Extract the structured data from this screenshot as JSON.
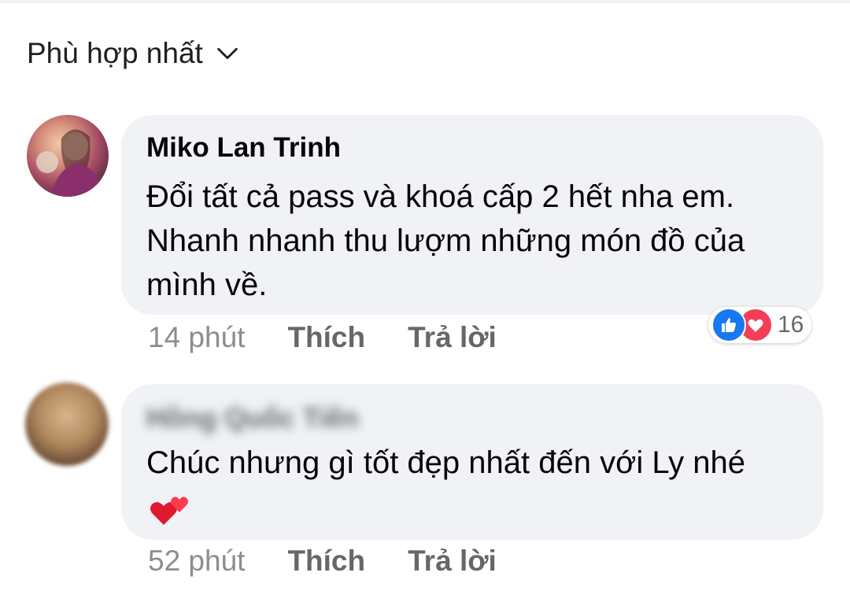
{
  "sort": {
    "label": "Phù hợp nhất",
    "icon": "chevron-down-icon"
  },
  "comments": [
    {
      "author": "Miko Lan Trinh",
      "text": "Đổi tất cả pass và khoá cấp 2 hết nha em. Nhanh nhanh thu lượm những món đồ của mình về.",
      "time": "14 phút",
      "like_label": "Thích",
      "reply_label": "Trả lời",
      "reactions": {
        "icons": [
          "like-icon",
          "love-icon"
        ],
        "count": "16"
      }
    },
    {
      "author": "Hồng Quốc Tiến",
      "author_blurred": true,
      "text": "Chúc nhưng gì tốt đẹp nhất đến với Ly nhé",
      "emoji": "two-hearts-icon",
      "time": "52 phút",
      "like_label": "Thích",
      "reply_label": "Trả lời"
    }
  ],
  "colors": {
    "bubble": "#f0f2f5",
    "like_blue": "#1877f2",
    "love_red": "#f33e58",
    "secondary_text": "#65676b"
  }
}
